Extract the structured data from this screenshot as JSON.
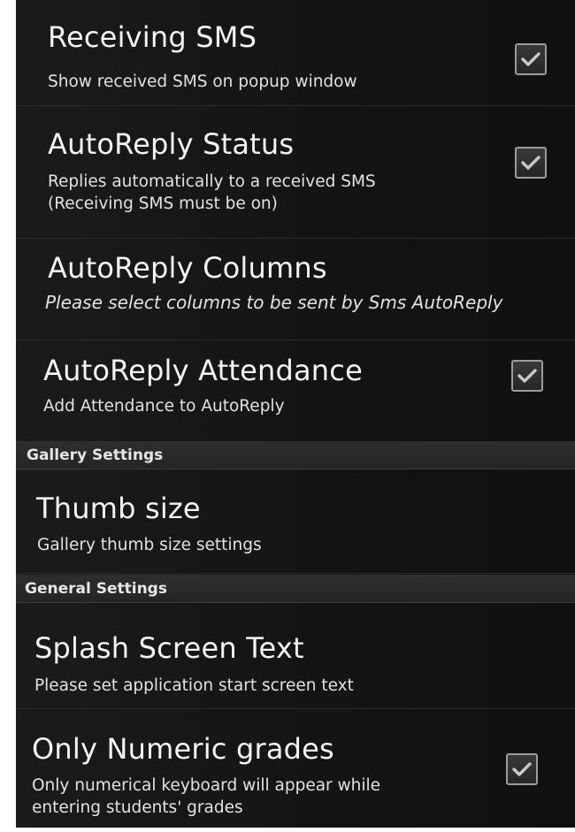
{
  "preferences": [
    {
      "title": "Receiving SMS",
      "summary": "Show received SMS on popup window",
      "checked": true,
      "icon": "checkmark-icon"
    },
    {
      "title": "AutoReply Status",
      "summary": "Replies automatically to a received SMS\n(Receiving SMS must be on)",
      "checked": true,
      "icon": "checkmark-icon"
    },
    {
      "title": "AutoReply Columns",
      "summary": "Please select columns to be sent by Sms AutoReply"
    },
    {
      "title": "AutoReply Attendance",
      "summary": "Add Attendance to AutoReply",
      "checked": true,
      "icon": "checkmark-icon"
    }
  ],
  "gallery_section": {
    "label": "Gallery Settings",
    "items": [
      {
        "title": "Thumb size",
        "summary": "Gallery thumb size settings"
      }
    ]
  },
  "general_section": {
    "label": "General Settings",
    "items": [
      {
        "title": "Splash Screen Text",
        "summary": "Please set application start screen text"
      },
      {
        "title": "Only Numeric grades",
        "summary": "Only numerical keyboard will appear while\nentering students' grades",
        "checked": true,
        "icon": "checkmark-icon"
      }
    ]
  },
  "colors": {
    "background": "#141414",
    "section_header": "#2a2a2a",
    "title_text": "#f4f4f4",
    "summary_text": "#e2e2e2",
    "checkmark": "#c8c8c8"
  }
}
